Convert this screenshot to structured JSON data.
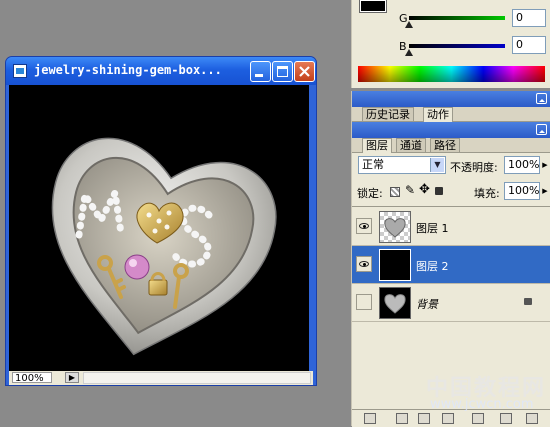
{
  "document": {
    "title": "jewelry-shining-gem-box...",
    "zoom": "100%"
  },
  "color_panel": {
    "g_label": "G",
    "g_value": "0",
    "b_label": "B",
    "b_value": "0"
  },
  "history_tabs": [
    {
      "label": "历史记录",
      "active": false
    },
    {
      "label": "动作",
      "active": true
    }
  ],
  "layers_tabs": [
    {
      "label": "图层",
      "active": true
    },
    {
      "label": "通道",
      "active": false
    },
    {
      "label": "路径",
      "active": false
    }
  ],
  "layers_panel": {
    "blend_mode": "正常",
    "opacity_label": "不透明度:",
    "opacity_value": "100%",
    "lock_label": "锁定:",
    "fill_label": "填充:",
    "fill_value": "100%",
    "layers": [
      {
        "name": "图层 1",
        "visible": true,
        "selected": false
      },
      {
        "name": "图层 2",
        "visible": true,
        "selected": true
      },
      {
        "name": "背景",
        "visible": false,
        "selected": false,
        "locked": true
      }
    ]
  },
  "watermark": {
    "text": "中国教程网",
    "url": "www.jcwcn.com"
  }
}
